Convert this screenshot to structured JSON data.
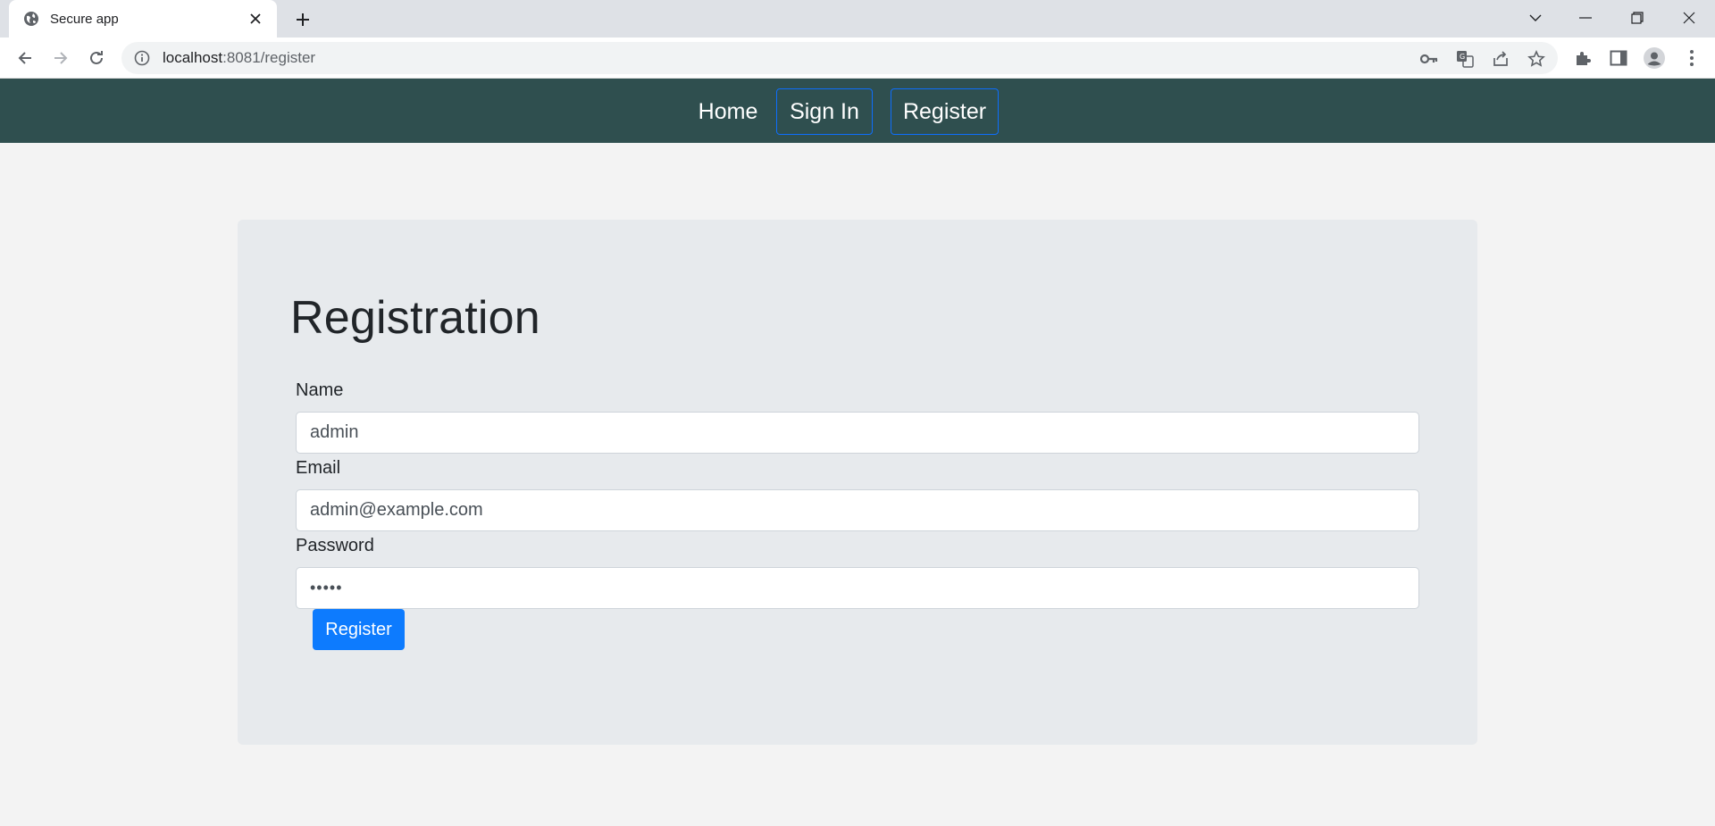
{
  "browser": {
    "tab_title": "Secure app",
    "url_host": "localhost",
    "url_rest": ":8081/register",
    "icons": {
      "favicon": "globe-icon",
      "close": "close-icon",
      "new_tab": "plus-icon",
      "back": "back-arrow-icon",
      "forward": "forward-arrow-icon",
      "reload": "reload-icon",
      "info": "info-icon",
      "key": "key-icon",
      "translate": "translate-icon",
      "share": "share-icon",
      "star": "star-icon",
      "extensions": "puzzle-icon",
      "side_panel": "side-panel-icon",
      "profile": "profile-icon",
      "menu": "kebab-menu-icon",
      "tab_search": "chevron-down-icon",
      "minimize": "minimize-icon",
      "restore": "restore-icon",
      "window_close": "window-close-icon"
    }
  },
  "nav": {
    "home": "Home",
    "sign_in": "Sign In",
    "register": "Register",
    "bg_color": "#2f4f4f",
    "outline_color": "#0d6efd"
  },
  "form": {
    "title": "Registration",
    "name_label": "Name",
    "name_value": "admin",
    "email_label": "Email",
    "email_value": "admin@example.com",
    "password_label": "Password",
    "password_value": "•••••",
    "submit_label": "Register",
    "submit_color": "#0d7bfe"
  }
}
